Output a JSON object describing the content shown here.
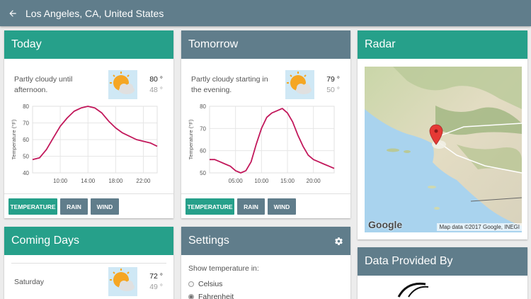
{
  "header": {
    "title": "Los Angeles, CA, United States"
  },
  "today": {
    "title": "Today",
    "summary": "Partly cloudy until afternoon.",
    "high": "80 °",
    "low": "48 °",
    "icon": "partly-cloudy-icon",
    "tabs": [
      "TEMPERATURE",
      "RAIN",
      "WIND"
    ],
    "chart_data": {
      "type": "line",
      "ylabel": "Temperature (°F)",
      "ylim": [
        40,
        80
      ],
      "yticks": [
        "40",
        "50",
        "60",
        "70",
        "80"
      ],
      "xlim": [
        6,
        24
      ],
      "xticks": [
        10,
        14,
        18,
        22
      ],
      "xtick_labels": [
        "10:00",
        "14:00",
        "18:00",
        "22:00"
      ],
      "x": [
        6,
        7,
        8,
        9,
        10,
        11,
        12,
        13,
        14,
        15,
        16,
        17,
        18,
        19,
        20,
        21,
        22,
        23,
        24
      ],
      "y": [
        48,
        49,
        54,
        61,
        68,
        73,
        77,
        79,
        80,
        79,
        76,
        71,
        67,
        64,
        62,
        60,
        59,
        58,
        56
      ],
      "color": "#c2185b"
    }
  },
  "tomorrow": {
    "title": "Tomorrow",
    "summary": "Partly cloudy starting in the evening.",
    "high": "79 °",
    "low": "50 °",
    "icon": "partly-cloudy-icon",
    "tabs": [
      "TEMPERATURE",
      "RAIN",
      "WIND"
    ],
    "chart_data": {
      "type": "line",
      "ylabel": "Temperature (°F)",
      "ylim": [
        50,
        80
      ],
      "yticks": [
        "50",
        "60",
        "70",
        "80"
      ],
      "xlim": [
        0,
        24
      ],
      "xticks": [
        5,
        10,
        15,
        20
      ],
      "xtick_labels": [
        "05:00",
        "10:00",
        "15:00",
        "20:00"
      ],
      "x": [
        0,
        1,
        2,
        3,
        4,
        5,
        6,
        7,
        8,
        9,
        10,
        11,
        12,
        13,
        14,
        15,
        16,
        17,
        18,
        19,
        20,
        21,
        22,
        23,
        24
      ],
      "y": [
        56,
        56,
        55,
        54,
        53,
        51,
        50,
        51,
        55,
        63,
        70,
        75,
        77,
        78,
        79,
        77,
        73,
        67,
        62,
        58,
        56,
        55,
        54,
        53,
        52
      ],
      "color": "#c2185b"
    }
  },
  "radar": {
    "title": "Radar",
    "attribution": "Map data ©2017 Google, INEGI",
    "logo": "Google"
  },
  "coming_days": {
    "title": "Coming Days",
    "day": "Saturday",
    "high": "72 °",
    "low": "49 °",
    "icon": "partly-cloudy-icon"
  },
  "settings": {
    "title": "Settings",
    "show_label": "Show temperature in:",
    "options": [
      "Celsius",
      "Fahrenheit"
    ],
    "selected": "Fahrenheit"
  },
  "provider": {
    "title": "Data Provided By"
  }
}
